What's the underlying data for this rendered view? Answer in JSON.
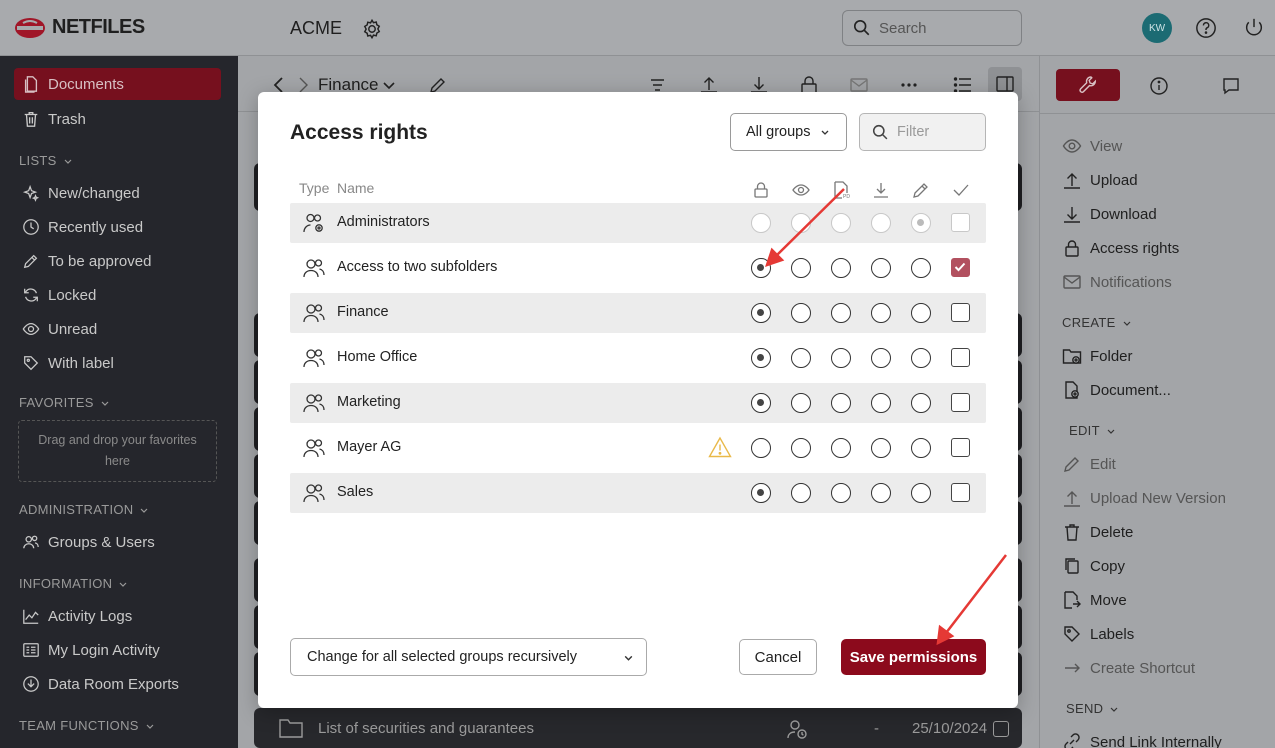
{
  "brand": {
    "name": "NETFILES"
  },
  "topbar": {
    "workspace": "ACME",
    "search_placeholder": "Search",
    "avatar_initials": "KW"
  },
  "sidebar": {
    "documents": "Documents",
    "trash": "Trash",
    "lists_label": "LISTS",
    "lists": [
      "New/changed",
      "Recently used",
      "To be approved",
      "Locked",
      "Unread",
      "With label"
    ],
    "favorites_label": "FAVORITES",
    "favorites_drop": "Drag and drop your favorites here",
    "admin_label": "ADMINISTRATION",
    "admin_items": [
      "Groups & Users"
    ],
    "info_label": "INFORMATION",
    "info_items": [
      "Activity Logs",
      "My Login Activity",
      "Data Room Exports"
    ],
    "team_label": "TEAM FUNCTIONS"
  },
  "toolbar": {
    "breadcrumb": "Finance"
  },
  "background_row": {
    "name": "List of securities and guarantees",
    "dash": "-",
    "date": "25/10/2024"
  },
  "right_panel": {
    "view_items": [
      "View",
      "Upload",
      "Download",
      "Access rights",
      "Notifications"
    ],
    "create_label": "CREATE",
    "create_items": [
      "Folder",
      "Document..."
    ],
    "edit_label": "EDIT",
    "edit_items": [
      "Edit",
      "Upload New Version",
      "Delete",
      "Copy",
      "Move",
      "Labels",
      "Create Shortcut"
    ],
    "send_label": "SEND",
    "send_items": [
      "Send Link Internally"
    ]
  },
  "modal": {
    "title": "Access rights",
    "group_filter": "All groups",
    "filter_placeholder": "Filter",
    "col_type": "Type",
    "col_name": "Name",
    "permission_columns": [
      "lock",
      "view",
      "pdf",
      "download",
      "edit",
      "approve"
    ],
    "groups": [
      {
        "name": "Administrators",
        "icon": "admin-group-icon",
        "selected": 4,
        "approve": false,
        "disabled": true,
        "warning": false
      },
      {
        "name": "Access to two subfolders",
        "icon": "group-icon",
        "selected": 0,
        "approve": true,
        "disabled": false,
        "warning": false
      },
      {
        "name": "Finance",
        "icon": "group-icon",
        "selected": 0,
        "approve": false,
        "disabled": false,
        "warning": false
      },
      {
        "name": "Home Office",
        "icon": "group-icon",
        "selected": 0,
        "approve": false,
        "disabled": false,
        "warning": false
      },
      {
        "name": "Marketing",
        "icon": "group-icon",
        "selected": 0,
        "approve": false,
        "disabled": false,
        "warning": false
      },
      {
        "name": "Mayer AG",
        "icon": "group-icon",
        "selected": null,
        "approve": false,
        "disabled": false,
        "warning": true
      },
      {
        "name": "Sales",
        "icon": "group-icon",
        "selected": 0,
        "approve": false,
        "disabled": false,
        "warning": false
      }
    ],
    "recursive_option": "Change for all selected groups recursively",
    "cancel": "Cancel",
    "save": "Save permissions"
  },
  "colors": {
    "brand_red": "#8c0a1c",
    "sidebar_active": "#76101e",
    "check_on": "#b2505f",
    "warning": "#e9b949",
    "arrow": "#e53935"
  }
}
